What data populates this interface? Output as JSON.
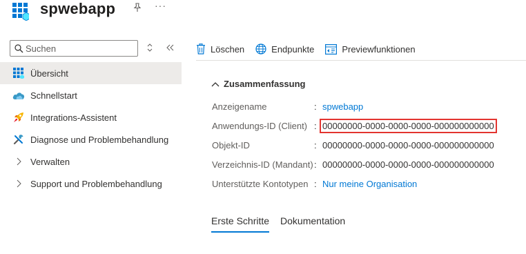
{
  "header": {
    "app_title": "spwebapp",
    "more_label": "···"
  },
  "sidebar": {
    "search_placeholder": "Suchen",
    "items": [
      {
        "label": "Übersicht",
        "icon": "app-grid-icon",
        "active": true
      },
      {
        "label": "Schnellstart",
        "icon": "cloud-icon"
      },
      {
        "label": "Integrations-Assistent",
        "icon": "rocket-icon"
      },
      {
        "label": "Diagnose und Problembehandlung",
        "icon": "wrench-icon"
      },
      {
        "label": "Verwalten",
        "icon": "chevron-right-icon"
      },
      {
        "label": "Support und Problembehandlung",
        "icon": "chevron-right-icon"
      }
    ]
  },
  "toolbar": {
    "delete_label": "Löschen",
    "endpoints_label": "Endpunkte",
    "preview_label": "Previewfunktionen"
  },
  "essentials": {
    "title": "Zusammenfassung",
    "rows": [
      {
        "label": "Anzeigename",
        "value": "spwebapp",
        "link": true
      },
      {
        "label": "Anwendungs-ID (Client)",
        "value": "00000000-0000-0000-0000-000000000000",
        "highlighted": true
      },
      {
        "label": "Objekt-ID",
        "value": "00000000-0000-0000-0000-000000000000"
      },
      {
        "label": "Verzeichnis-ID (Mandant)",
        "value": "00000000-0000-0000-0000-000000000000"
      },
      {
        "label": "Unterstützte Kontotypen",
        "value": "Nur meine Organisation",
        "link": true
      }
    ]
  },
  "tabs": [
    {
      "label": "Erste Schritte",
      "active": true
    },
    {
      "label": "Dokumentation"
    }
  ],
  "colors": {
    "accent": "#0078d4",
    "highlight_border": "#e3342f",
    "active_nav_bg": "#edebe9"
  }
}
